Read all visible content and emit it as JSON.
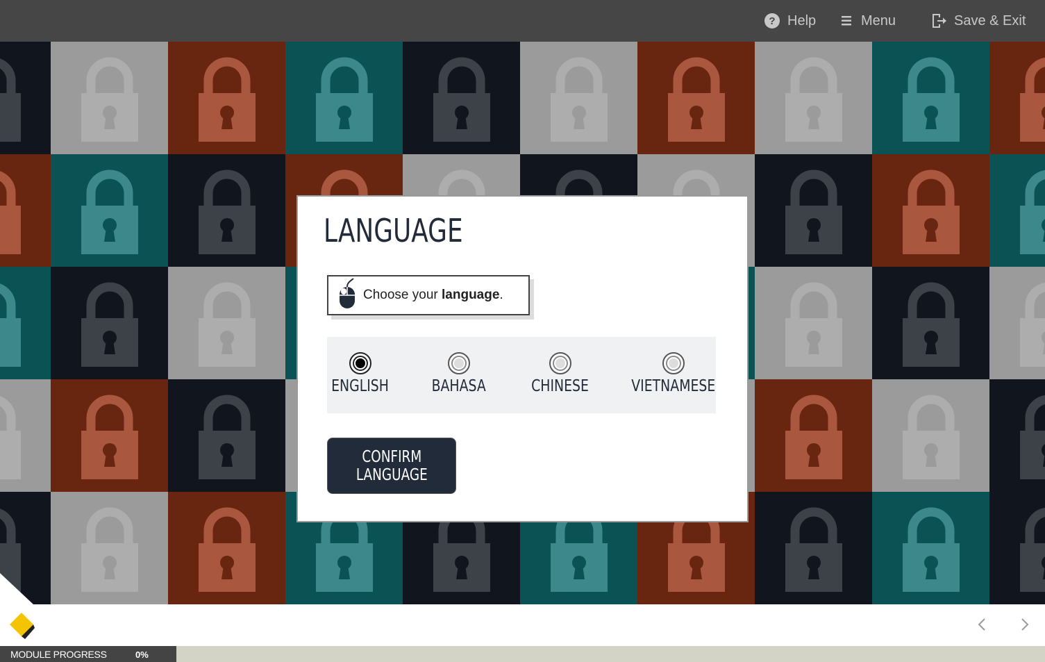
{
  "topbar": {
    "help_label": "Help",
    "menu_label": "Menu",
    "save_exit_label": "Save & Exit",
    "icons": [
      "help-icon",
      "menu-icon",
      "exit-icon"
    ]
  },
  "dialog": {
    "title": "LANGUAGE",
    "instruction_prefix": "Choose your ",
    "instruction_bold": "language",
    "instruction_suffix": ".",
    "options": [
      {
        "label": "ENGLISH",
        "selected": true
      },
      {
        "label": "BAHASA",
        "selected": false
      },
      {
        "label": "CHINESE",
        "selected": false
      },
      {
        "label": "VIETNAMESE",
        "selected": false
      }
    ],
    "confirm_label": "CONFIRM\nLANGUAGE"
  },
  "footer": {
    "progress_label": "MODULE PROGRESS",
    "progress_value": "0%"
  },
  "colors": {
    "topbar": "#464646",
    "navy": "#222b3a",
    "tile_orange": "#7f2e14",
    "tile_teal": "#0e6468",
    "tile_dark": "#151b25",
    "tile_grey": "#bdbdbd",
    "logo_yellow": "#f5c400"
  }
}
